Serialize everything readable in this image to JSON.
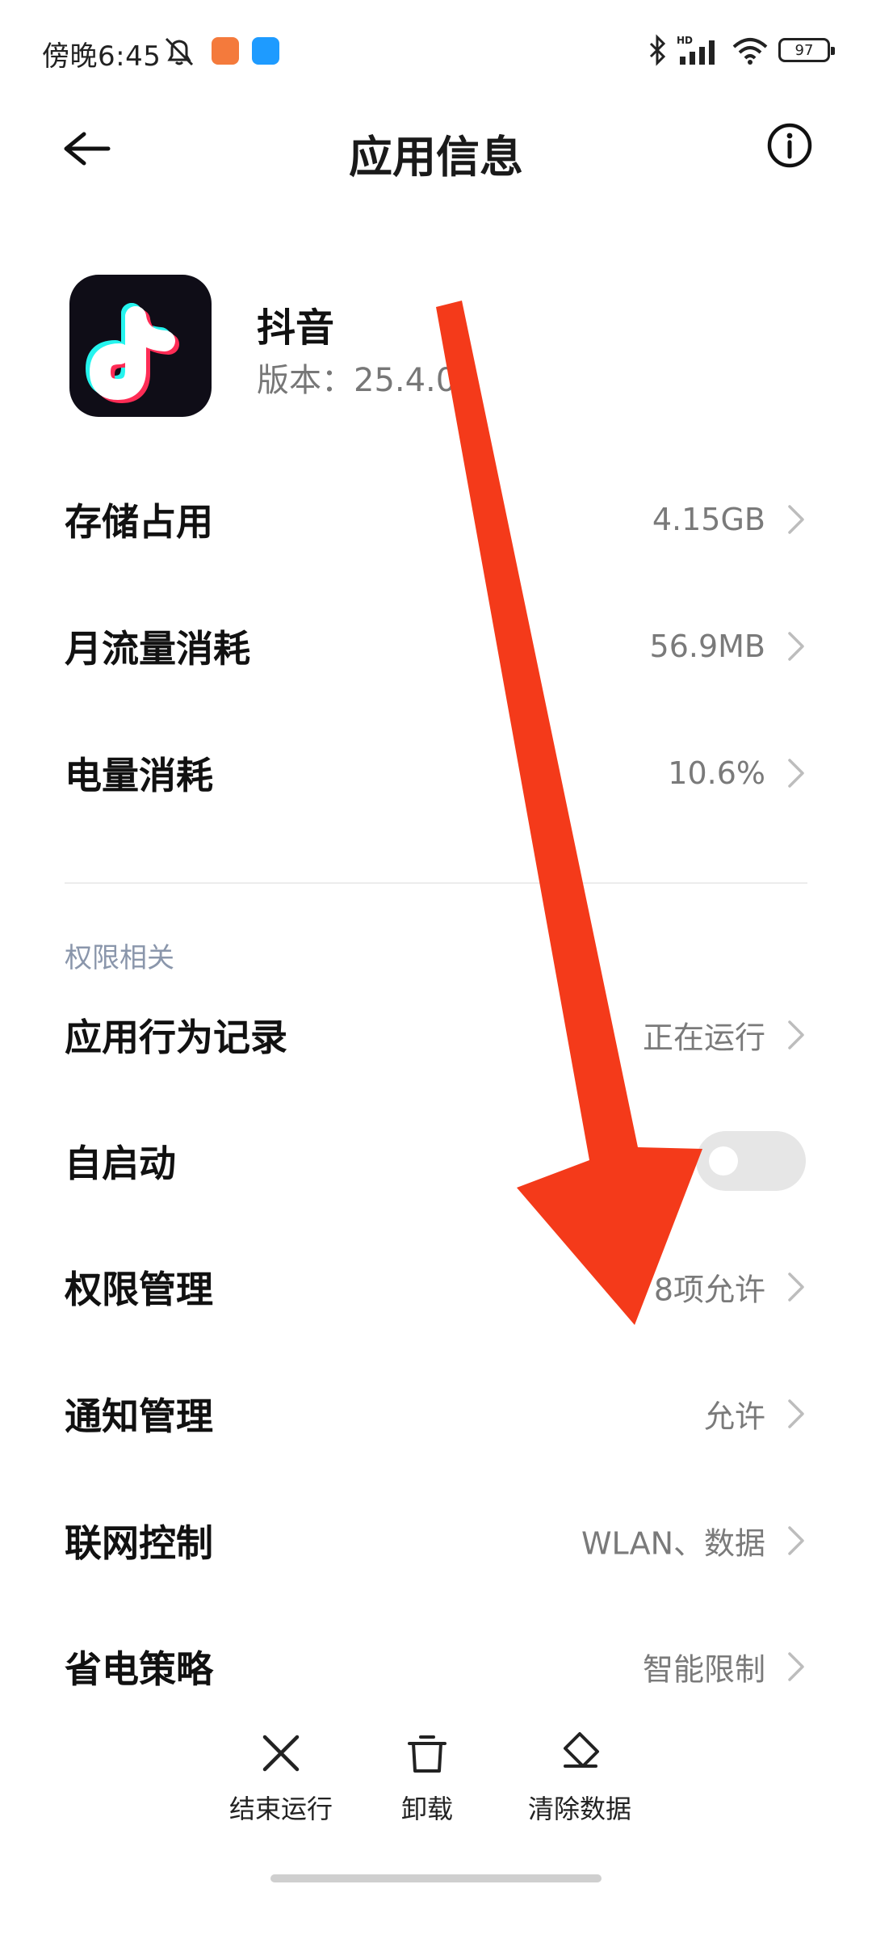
{
  "status_bar": {
    "time": "傍晚6:45",
    "battery": "97",
    "network_label": "HD"
  },
  "header": {
    "title": "应用信息"
  },
  "app": {
    "name": "抖音",
    "version": "版本：25.4.0"
  },
  "usage_rows": [
    {
      "label": "存储占用",
      "value": "4.15GB"
    },
    {
      "label": "月流量消耗",
      "value": "56.9MB"
    },
    {
      "label": "电量消耗",
      "value": "10.6%"
    }
  ],
  "permissions_section": {
    "title": "权限相关",
    "rows": [
      {
        "label": "应用行为记录",
        "value": "正在运行"
      },
      {
        "label": "自启动",
        "toggle_on": false
      },
      {
        "label": "权限管理",
        "value": "8项允许"
      },
      {
        "label": "通知管理",
        "value": "允许"
      },
      {
        "label": "联网控制",
        "value": "WLAN、数据"
      },
      {
        "label": "省电策略",
        "value": "智能限制"
      }
    ]
  },
  "bottom_actions": [
    {
      "label": "结束运行",
      "icon": "close-icon"
    },
    {
      "label": "卸载",
      "icon": "trash-icon"
    },
    {
      "label": "清除数据",
      "icon": "eraser-icon"
    }
  ],
  "colors": {
    "annotation_arrow": "#f43a1a",
    "section_title": "#8a96ab",
    "secondary_text": "#7a7a7a"
  }
}
